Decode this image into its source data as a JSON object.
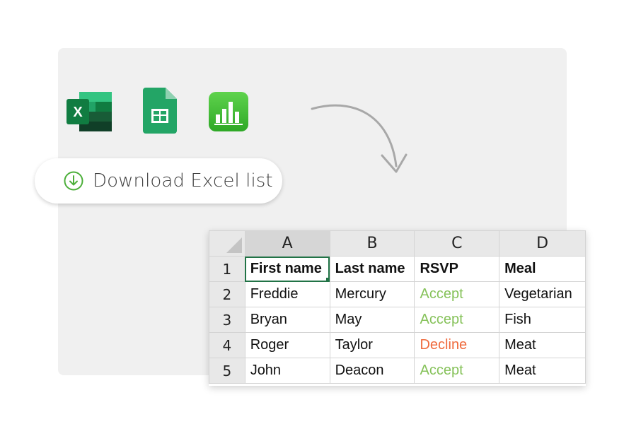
{
  "app_icons": [
    {
      "name": "excel-icon",
      "letter": "X",
      "color": "#1d6f42"
    },
    {
      "name": "google-sheets-icon",
      "color": "#1fa463"
    },
    {
      "name": "numbers-icon",
      "color": "#3ebe2e"
    }
  ],
  "download": {
    "label": "Download Excel list",
    "icon": "download-circle-icon",
    "accent": "#4caf3a"
  },
  "spreadsheet": {
    "columns": [
      "A",
      "B",
      "C",
      "D"
    ],
    "row_numbers": [
      "1",
      "2",
      "3",
      "4",
      "5"
    ],
    "selected_cell": "A1",
    "rows": [
      [
        "First name",
        "Last name",
        "RSVP",
        "Meal"
      ],
      [
        "Freddie",
        "Mercury",
        "Accept",
        "Vegetarian"
      ],
      [
        "Bryan",
        "May",
        "Accept",
        "Fish"
      ],
      [
        "Roger",
        "Taylor",
        "Decline",
        "Meat"
      ],
      [
        "John",
        "Deacon",
        "Accept",
        "Meat"
      ]
    ],
    "status_colors": {
      "Accept": "#86c25a",
      "Decline": "#ef6a3c"
    }
  }
}
